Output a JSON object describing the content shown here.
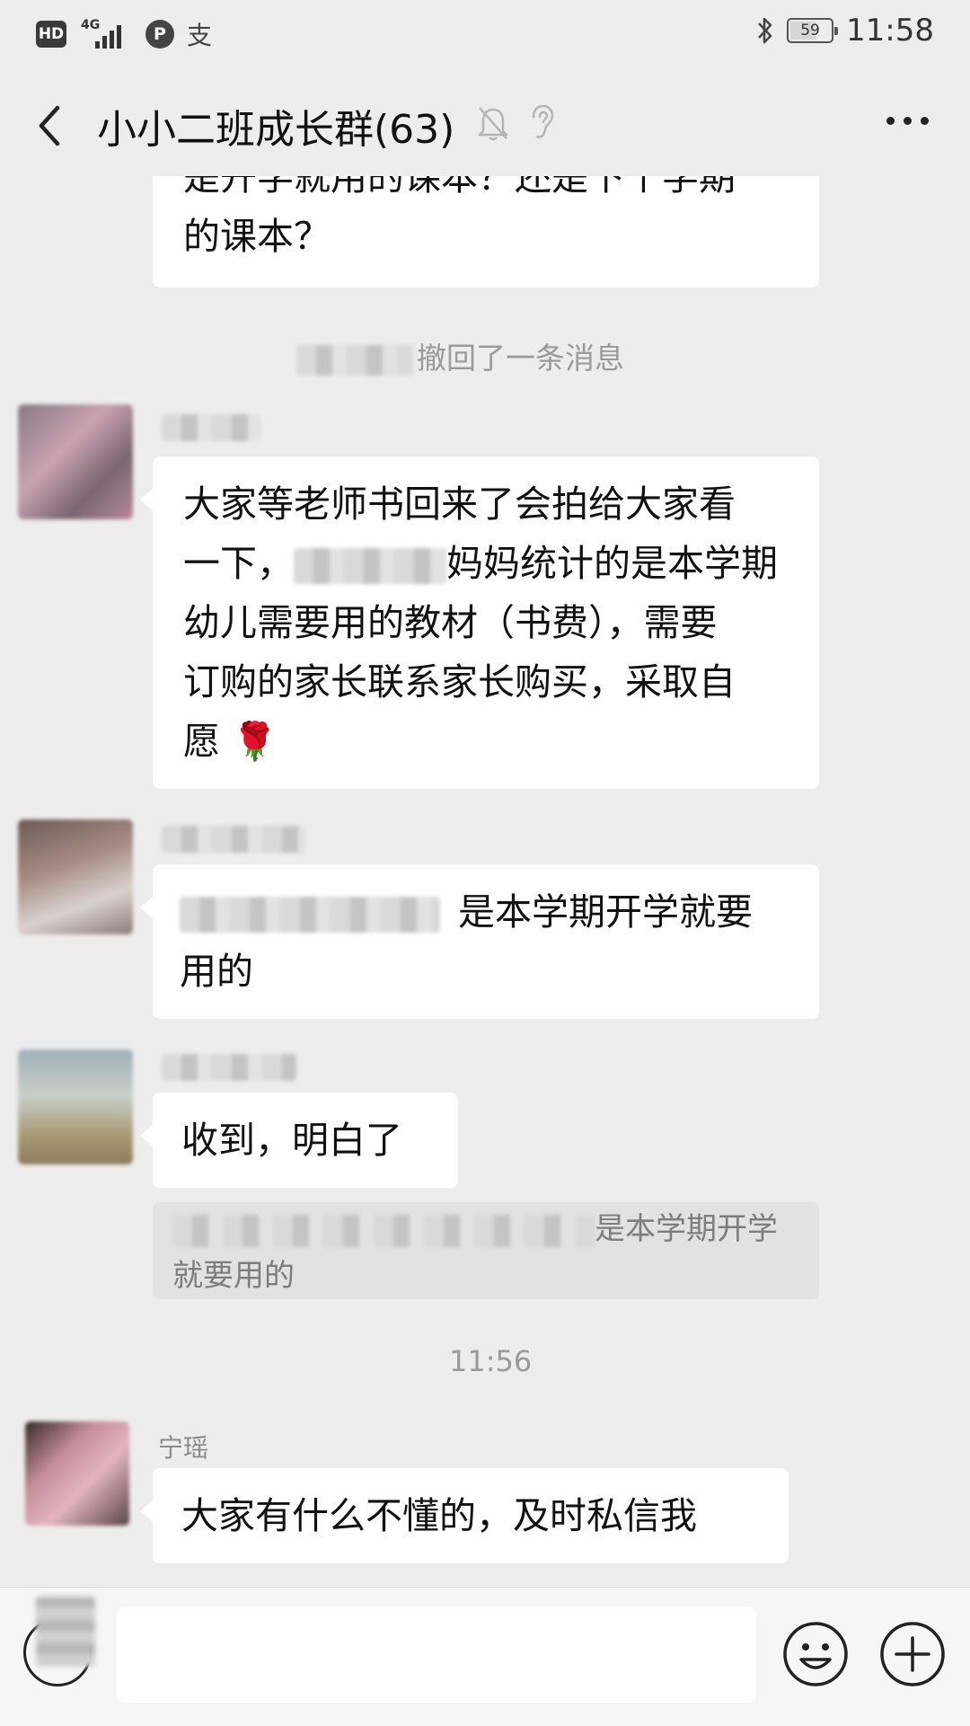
{
  "status_bar": {
    "hd": "HD",
    "network": "4G",
    "p_icon": "P",
    "alipay": "支",
    "battery": "59",
    "time": "11:58"
  },
  "header": {
    "title": "小小二班成长群(63)"
  },
  "messages": {
    "m1_line1": "是开学就用的课本？还是下个学期",
    "m1_line2": "的课本？",
    "recall_text": "撤回了一条消息",
    "m2_l1": "大家等老师书回来了会拍给大家看",
    "m2_l2_a": "一下，",
    "m2_l2_b": "妈妈统计的是本学期",
    "m2_l3": "幼儿需要用的教材（书费），需要",
    "m2_l4": "订购的家长联系家长购买，采取自",
    "m2_l5": "愿",
    "m2_emoji": "🌹",
    "m3_l1": "是本学期开学就要",
    "m3_l2": "用的",
    "m4": "收到，明白了",
    "quote_l1": "是本学期开学",
    "quote_l2": "就要用的",
    "timestamp": "11:56",
    "sender_ningyao": "宁瑶",
    "m5": "大家有什么不懂的，及时私信我"
  },
  "input": {
    "placeholder": ""
  },
  "icons": {
    "back": "back-arrow-icon",
    "mute": "mute-bell-icon",
    "ear": "earpiece-icon",
    "more": "more-icon",
    "voice": "voice-icon",
    "emoji": "emoji-icon",
    "plus": "plus-icon"
  }
}
